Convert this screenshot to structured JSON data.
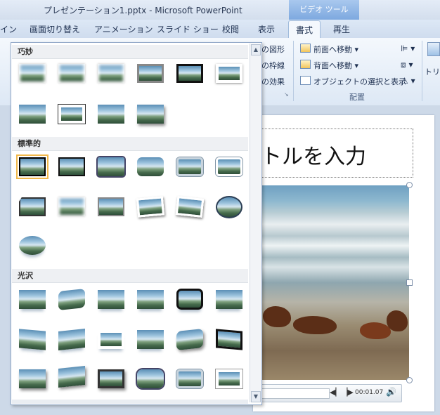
{
  "window": {
    "title": "プレゼンテーション1.pptx  -  Microsoft PowerPoint",
    "contextual_tab": "ビデオ ツール"
  },
  "tabs": [
    {
      "label": "イン"
    },
    {
      "label": "画面切り替え"
    },
    {
      "label": "アニメーション"
    },
    {
      "label": "スライド ショー"
    },
    {
      "label": "校閲"
    },
    {
      "label": "表示"
    },
    {
      "label": "書式",
      "active": true
    },
    {
      "label": "再生"
    }
  ],
  "ribbon": {
    "items": {
      "shape": "の図形",
      "border": "の枠線",
      "effect": "の効果",
      "bring_forward": "前面へ移動",
      "send_backward": "背面へ移動",
      "selection_pane": "オブジェクトの選択と表示",
      "trim": "トリミ"
    },
    "group_arrange": "配置"
  },
  "gallery": {
    "categories": [
      {
        "label": "巧妙"
      },
      {
        "label": "標準的"
      },
      {
        "label": "光沢"
      }
    ]
  },
  "slide": {
    "title_placeholder": "トルを入力"
  },
  "video_controls": {
    "time": "00:01.07"
  },
  "colors": {
    "ribbon_bg": "#dde8f5",
    "active_tab": "#f4f8fd",
    "video_tools": "#7aa6de",
    "selection": "#f1b84b"
  }
}
